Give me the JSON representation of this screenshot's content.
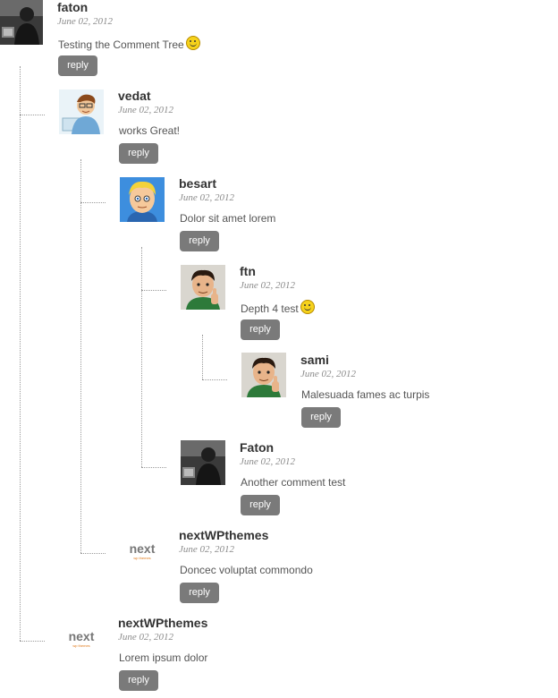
{
  "comments": [
    {
      "name": "faton",
      "date": "June 02, 2012",
      "text": "Testing the Comment Tree",
      "reply": "reply",
      "avatar": "photo-avatar"
    },
    {
      "name": "vedat",
      "date": "June 02, 2012",
      "text": "works Great!",
      "reply": "reply",
      "avatar": "cartoon-office-avatar"
    },
    {
      "name": "besart",
      "date": "June 02, 2012",
      "text": "Dolor sit amet lorem",
      "reply": "reply",
      "avatar": "cartoon-blonde-avatar"
    },
    {
      "name": "ftn",
      "date": "June 02, 2012",
      "text": "Depth 4 test",
      "reply": "reply",
      "avatar": "cartoon-thumbs-up-avatar"
    },
    {
      "name": "sami",
      "date": "June 02, 2012",
      "text": "Malesuada fames ac turpis",
      "reply": "reply",
      "avatar": "cartoon-thumbs-up-avatar"
    },
    {
      "name": "Faton",
      "date": "June 02, 2012",
      "text": "Another comment test",
      "reply": "reply",
      "avatar": "photo-avatar"
    },
    {
      "name": "nextWPthemes",
      "date": "June 02, 2012",
      "text": "Doncec voluptat commondo",
      "reply": "reply",
      "avatar": "next-logo"
    },
    {
      "name": "nextWPthemes",
      "date": "June 02, 2012",
      "text": "Lorem ipsum dolor",
      "reply": "reply",
      "avatar": "next-logo"
    }
  ],
  "logo_text": "next",
  "logo_subtext": "wp themes"
}
